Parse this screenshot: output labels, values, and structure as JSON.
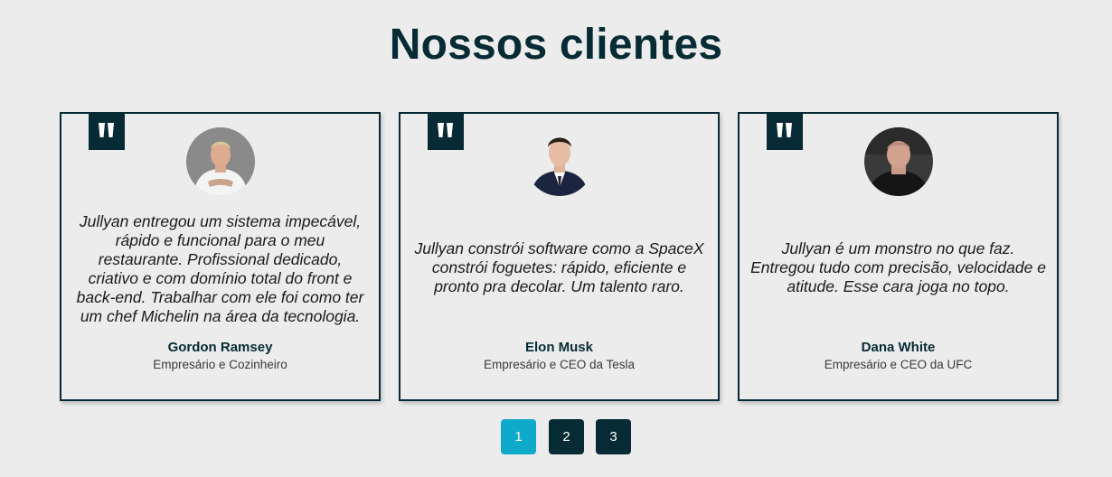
{
  "section": {
    "title": "Nossos clientes"
  },
  "testimonials": [
    {
      "quote_icon": "quote-icon",
      "text": "Jullyan entregou um sistema impecável, rápido e funcional para o meu restaurante. Profissional dedicado, criativo e com domínio total do front e back-end. Trabalhar com ele foi como ter um chef Michelin na área da tecnologia.",
      "name": "Gordon Ramsey",
      "role": "Empresário e Cozinheiro"
    },
    {
      "quote_icon": "quote-icon",
      "text": "Jullyan constrói software como a SpaceX constrói foguetes: rápido, eficiente e pronto pra decolar. Um talento raro.",
      "name": "Elon Musk",
      "role": "Empresário e CEO da Tesla"
    },
    {
      "quote_icon": "quote-icon",
      "text": "Jullyan é um monstro no que faz. Entregou tudo com precisão, velocidade e atitude. Esse cara joga no topo.",
      "name": "Dana White",
      "role": "Empresário e CEO da UFC"
    }
  ],
  "pagination": {
    "pages": [
      "1",
      "2",
      "3"
    ],
    "active": "1"
  },
  "colors": {
    "background": "#ececec",
    "primary": "#062b35",
    "accent": "#0fa9c9"
  }
}
